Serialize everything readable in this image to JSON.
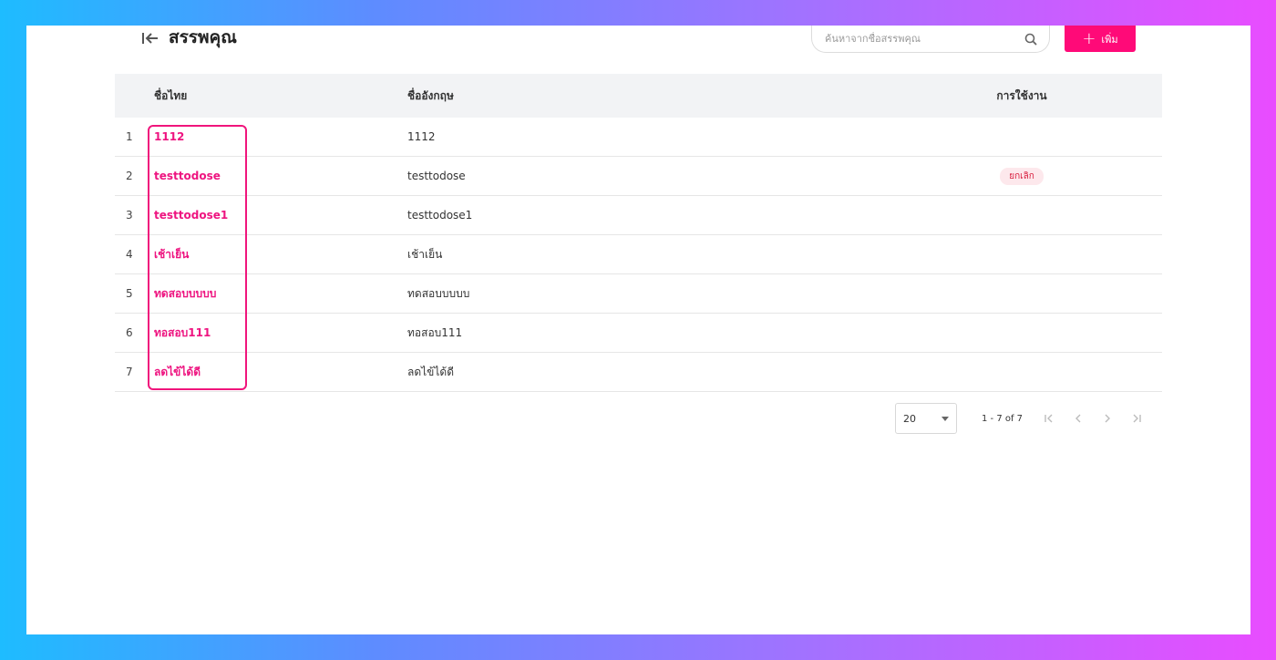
{
  "header": {
    "title": "สรรพคุณ",
    "search_placeholder": "ค้นหาจากชื่อสรรพคุณ",
    "add_label": "เพิ่ม"
  },
  "table": {
    "columns": {
      "thai": "ชื่อไทย",
      "english": "ชื่ออังกฤษ",
      "status": "การใช้งาน"
    },
    "rows": [
      {
        "index": "1",
        "thai": "1112",
        "english": "1112",
        "status": ""
      },
      {
        "index": "2",
        "thai": "testtodose",
        "english": "testtodose",
        "status": "ยกเลิก"
      },
      {
        "index": "3",
        "thai": "testtodose1",
        "english": "testtodose1",
        "status": ""
      },
      {
        "index": "4",
        "thai": "เช้าเย็น",
        "english": "เช้าเย็น",
        "status": ""
      },
      {
        "index": "5",
        "thai": "ทดสอบบบบบ",
        "english": "ทดสอบบบบบ",
        "status": ""
      },
      {
        "index": "6",
        "thai": "ทอสอบ111",
        "english": "ทอสอบ111",
        "status": ""
      },
      {
        "index": "7",
        "thai": "ลดไข้ได้ดี",
        "english": "ลดไข้ได้ดี",
        "status": ""
      }
    ]
  },
  "pagination": {
    "page_size": "20",
    "range": "1 - 7 of 7"
  },
  "colors": {
    "accent": "#ff0a78",
    "link": "#ee1480",
    "cancel_badge": "#d81b3c"
  }
}
